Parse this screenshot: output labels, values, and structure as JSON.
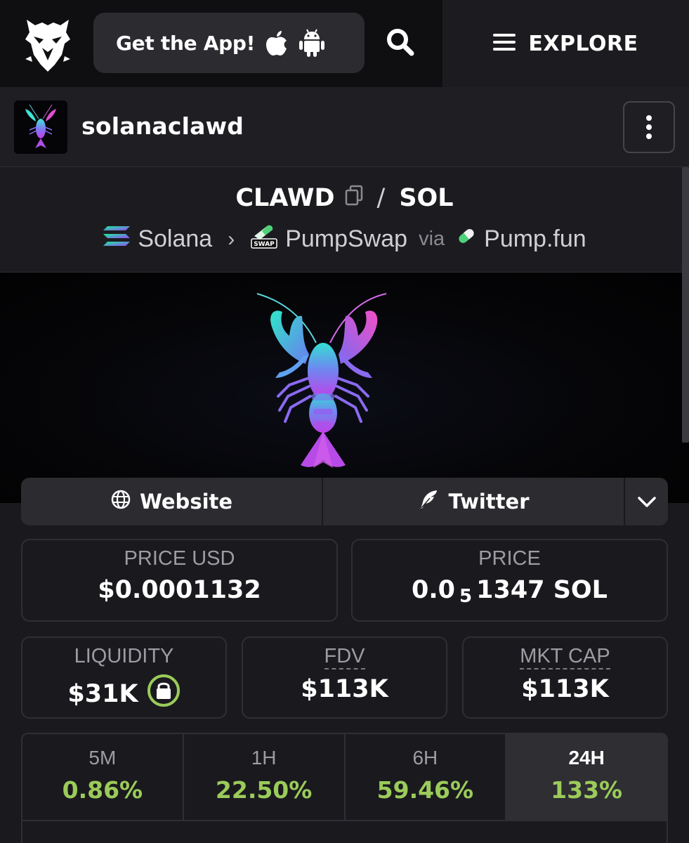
{
  "header": {
    "get_app_label": "Get the App!",
    "explore_label": "EXPLORE",
    "icons": [
      "eagle-logo-icon",
      "apple-icon",
      "android-icon",
      "search-icon",
      "menu-icon"
    ]
  },
  "profile": {
    "name": "solanaclawd",
    "icons": [
      "more-vertical-icon"
    ]
  },
  "pair": {
    "base": "CLAWD",
    "separator": "/",
    "quote": "SOL",
    "chain": "Solana",
    "dex": "PumpSwap",
    "via": "via",
    "launchpad": "Pump.fun"
  },
  "links": {
    "website": "Website",
    "twitter": "Twitter"
  },
  "stats": {
    "price_usd_label": "PRICE USD",
    "price_usd": "$0.0001132",
    "price_label": "PRICE",
    "price_prefix": "0.0",
    "price_zeros": "5",
    "price_suffix": "1347 SOL",
    "liquidity_label": "LIQUIDITY",
    "liquidity": "$31K",
    "fdv_label": "FDV",
    "fdv": "$113K",
    "mktcap_label": "MKT CAP",
    "mktcap": "$113K"
  },
  "changes": [
    {
      "label": "5M",
      "value": "0.86%"
    },
    {
      "label": "1H",
      "value": "22.50%"
    },
    {
      "label": "6H",
      "value": "59.46%"
    },
    {
      "label": "24H",
      "value": "133%"
    }
  ],
  "colors": {
    "positive": "#9bcb5a",
    "background": "#1a1a1e",
    "lock_ring": "#9bcb5a"
  }
}
